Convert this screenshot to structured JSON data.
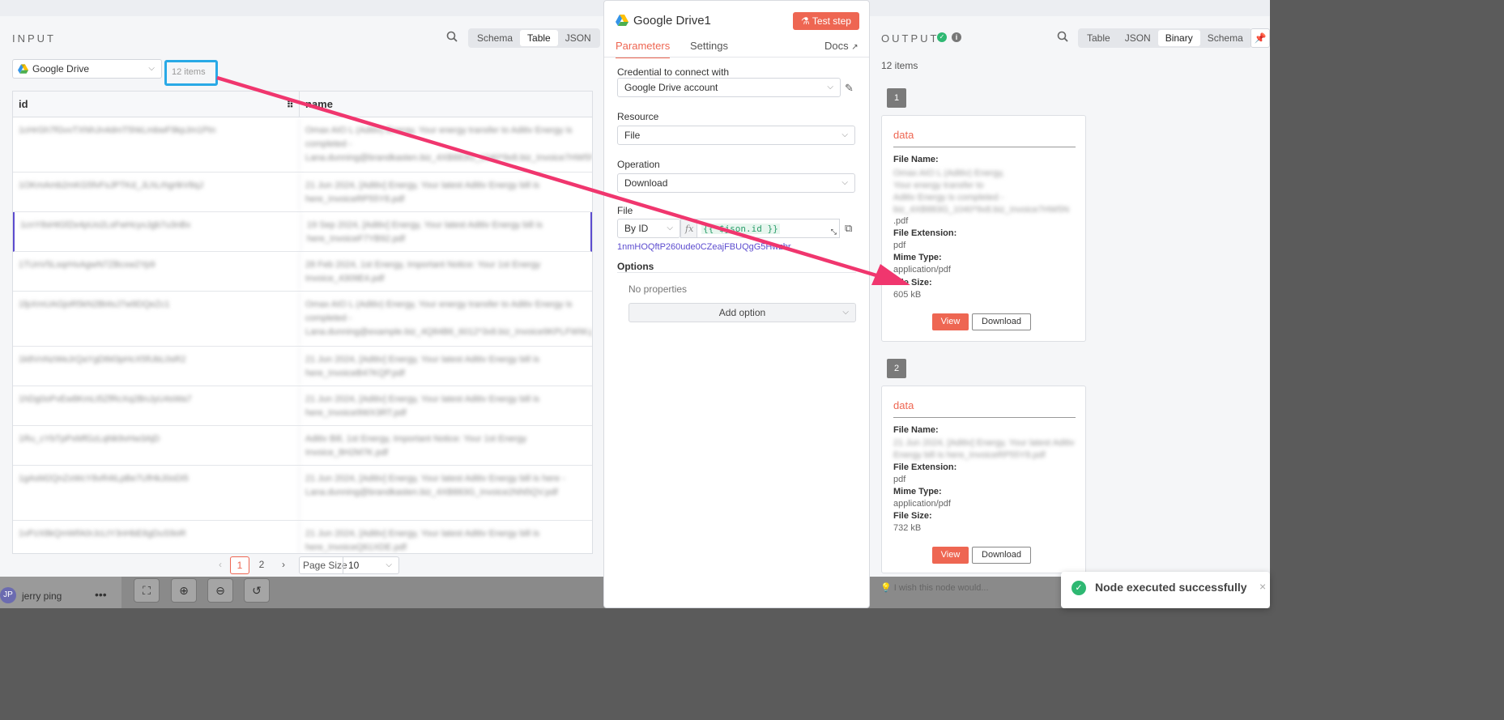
{
  "background": {
    "user_initials": "JP",
    "user_name": "jerry ping",
    "more": "•••"
  },
  "input": {
    "title": "INPUT",
    "view_modes": [
      "Schema",
      "Table",
      "JSON"
    ],
    "active_view": "Table",
    "source_select": "Google Drive",
    "items_count": "12 items",
    "columns": [
      "id",
      "name"
    ],
    "rows": [
      {
        "id": "1cHrGh7fGvvTXNhJn4dmT5hkLmbwF9kpJm1Ptn",
        "name": "Omax AIO L (Aditiv) Energy, Your energy transfer to Aditiv Energy is completed - Lana.dunning@brandkasten.biz_4XB883G_1040*9x8.biz_Invoice7HW5NGI20.pdf"
      },
      {
        "id": "1OKmAmb2mKG5fvFsJPTKd_JLhLrhgrtkV8qJ",
        "name": "21 Jun 2024, [Aditiv] Energy, Your latest Aditiv Energy bill is here_InvoiceRP55Y8.pdf"
      },
      {
        "id": "1cnY8sHtGfZe4pUo2LsFwHcyxJgb7u3nBx",
        "name": "19 Sep 2024, [Aditiv] Energy, Your latest Aditiv Energy bill is here_InvoiceF7YB92.pdf"
      },
      {
        "id": "1TUnV5LsqrHxAgwN7ZBcxw2Yp9",
        "name": "28 Feb 2024, 1st Energy, Important Notice: Your 1st Energy Invoice_4309E4.pdf"
      },
      {
        "id": "1fpXmUAGjoR5kN2Bt4sJ7w9DQeZc1",
        "name": "Omax AIO L (Aditiv) Energy, Your energy transfer to Aditiv Energy is completed - Lana.dunning@example.biz_4Q84B6_6012*3x8.biz_Invoice9KPLFWW.pdf"
      },
      {
        "id": "1k8VnNzWeJrQaYgDtM3pHcX5fUbL0sR2",
        "name": "21 Jun 2024, [Aditiv] Energy, Your latest Aditiv Energy bill is here_InvoiceB47KQP.pdf"
      },
      {
        "id": "1hDg0oPvEw8KmLt5ZfRcXq2BnJyU4sWa7",
        "name": "21 Jun 2024, [Aditiv] Energy, Your latest Aditiv Energy bill is here_Invoice9WX3RT.pdf"
      },
      {
        "id": "1Ru_cYbTpPxMfGzLqNk9vHw3AjD",
        "name": "Aditiv Bill, 1st Energy, Important Notice: Your 1st Energy Invoice_8H2M7K.pdf"
      },
      {
        "id": "1gAsM2QnZxWcY8vR4tLpBe7UfHkJ0oDi5",
        "name": "21 Jun 2024, [Aditiv] Energy, Your latest Aditiv Energy bill is here - Lana.dunning@brandkasten.biz_4XB883G_Invoice2NN5QV.pdf"
      },
      {
        "id": "1vPzX8kQmWfA0rJcLtY3nHbE6gDuS9oR",
        "name": "21 Jun 2024, [Aditiv] Energy, Your latest Aditiv Energy bill is here_InvoiceQ61XDE.pdf"
      }
    ],
    "pagination": {
      "prev": "‹",
      "pages": [
        "1",
        "2"
      ],
      "active_page": "1",
      "next": "›",
      "page_size_label": "Page Size",
      "page_size": "10"
    }
  },
  "node": {
    "title": "Google Drive1",
    "test_step": "Test step",
    "tabs": [
      "Parameters",
      "Settings"
    ],
    "active_tab": "Parameters",
    "docs": "Docs",
    "credential_label": "Credential to connect with",
    "credential_value": "Google Drive account",
    "resource_label": "Resource",
    "resource_value": "File",
    "operation_label": "Operation",
    "operation_value": "Download",
    "file_label": "File",
    "file_mode": "By ID",
    "fx": "fx",
    "file_expression": "{{ $json.id }}",
    "file_id_preview": "1nmHOQftP260ude0CZeajFBUQgG5Hwzbr",
    "options_label": "Options",
    "no_properties": "No properties",
    "add_option": "Add option",
    "wish": "I wish this node would..."
  },
  "output": {
    "title": "OUTPUT",
    "view_modes": [
      "Table",
      "JSON",
      "Binary",
      "Schema"
    ],
    "active_view": "Binary",
    "items_count": "12 items",
    "items": [
      {
        "index": "1",
        "key": "data",
        "file_name_label": "File Name:",
        "file_name_lines": [
          "Omax AIO L (Aditiv) Energy,",
          "Your energy transfer to",
          "Aditiv Energy is completed -",
          "biz_4XB883G_1040*9x8.biz_Invoice7HW5N"
        ],
        "file_name_tail": ".pdf",
        "ext_label": "File Extension:",
        "ext": "pdf",
        "mime_label": "Mime Type:",
        "mime": "application/pdf",
        "size_label": "File Size:",
        "size": "605 kB",
        "view": "View",
        "download": "Download"
      },
      {
        "index": "2",
        "key": "data",
        "file_name_label": "File Name:",
        "file_name_lines": [
          "21 Jun 2024, [Aditiv] Energy, Your latest Aditiv",
          "Energy bill is here_InvoiceRP55Y8.pdf"
        ],
        "ext_label": "File Extension:",
        "ext": "pdf",
        "mime_label": "Mime Type:",
        "mime": "application/pdf",
        "size_label": "File Size:",
        "size": "732 kB",
        "view": "View",
        "download": "Download"
      }
    ]
  },
  "toast": {
    "message": "Node executed successfully",
    "close": "×"
  },
  "annotation_color": "#f0366e",
  "highlight_color": "#29a9e6",
  "accent_color": "#ee6652"
}
